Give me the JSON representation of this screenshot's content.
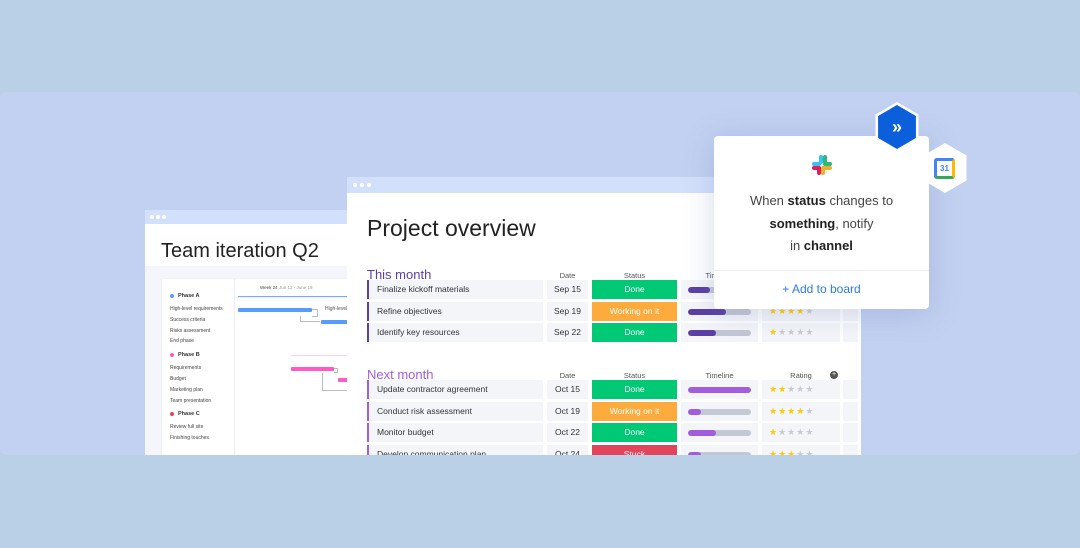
{
  "team_window": {
    "title": "Team iteration Q2",
    "week_label": "Week 24",
    "week_range": "Jun 12 - June 18",
    "bar_label": "High-level",
    "phases": [
      {
        "name": "Phase A",
        "color": "#579bfc",
        "items": [
          "High-level requirements",
          "Success criteria",
          "Risks assessment",
          "End phase"
        ]
      },
      {
        "name": "Phase B",
        "color": "#ff5ac4",
        "items": [
          "Requirements",
          "Budget",
          "Marketing plan",
          "Team presentation"
        ]
      },
      {
        "name": "Phase C",
        "color": "#e2445c",
        "items": [
          "Review full site",
          "Finishing touches"
        ]
      }
    ]
  },
  "project_window": {
    "title": "Project overview",
    "columns": {
      "date": "Date",
      "status": "Status",
      "timeline": "Timeline",
      "rating": "Rating"
    },
    "groups": [
      {
        "name": "This month",
        "color": "#5b3fa5",
        "timeline_color": "#5b3fa5",
        "rows": [
          {
            "task": "Finalize kickoff materials",
            "date": "Sep 15",
            "status": "Done",
            "timeline": 0.35,
            "rating": null
          },
          {
            "task": "Refine objectives",
            "date": "Sep 19",
            "status": "Working on it",
            "timeline": 0.6,
            "rating": 4
          },
          {
            "task": "Identify key resources",
            "date": "Sep 22",
            "status": "Done",
            "timeline": 0.45,
            "rating": 1
          }
        ]
      },
      {
        "name": "Next month",
        "color": "#a25ddc",
        "timeline_color": "#a25ddc",
        "rows": [
          {
            "task": "Update contractor agreement",
            "date": "Oct 15",
            "status": "Done",
            "timeline": 1.0,
            "rating": 2
          },
          {
            "task": "Conduct risk assessment",
            "date": "Oct 19",
            "status": "Working on it",
            "timeline": 0.2,
            "rating": 4
          },
          {
            "task": "Monitor budget",
            "date": "Oct 22",
            "status": "Done",
            "timeline": 0.45,
            "rating": 1
          },
          {
            "task": "Develop communication plan",
            "date": "Oct 24",
            "status": "Stuck",
            "timeline": 0.2,
            "rating": 3
          }
        ]
      }
    ],
    "status_colors": {
      "Done": "#00c875",
      "Working on it": "#fdab3d",
      "Stuck": "#e2445c"
    }
  },
  "popup": {
    "pre1": "When ",
    "b1": "status",
    "mid1": " changes to",
    "b2": "something",
    "mid2": ", notify",
    "pre3": "in ",
    "b3": "channel",
    "add_label": "+ Add to board",
    "icons": [
      "slack-icon",
      "jira-icon",
      "google-calendar-icon"
    ],
    "calendar_day": "31"
  }
}
